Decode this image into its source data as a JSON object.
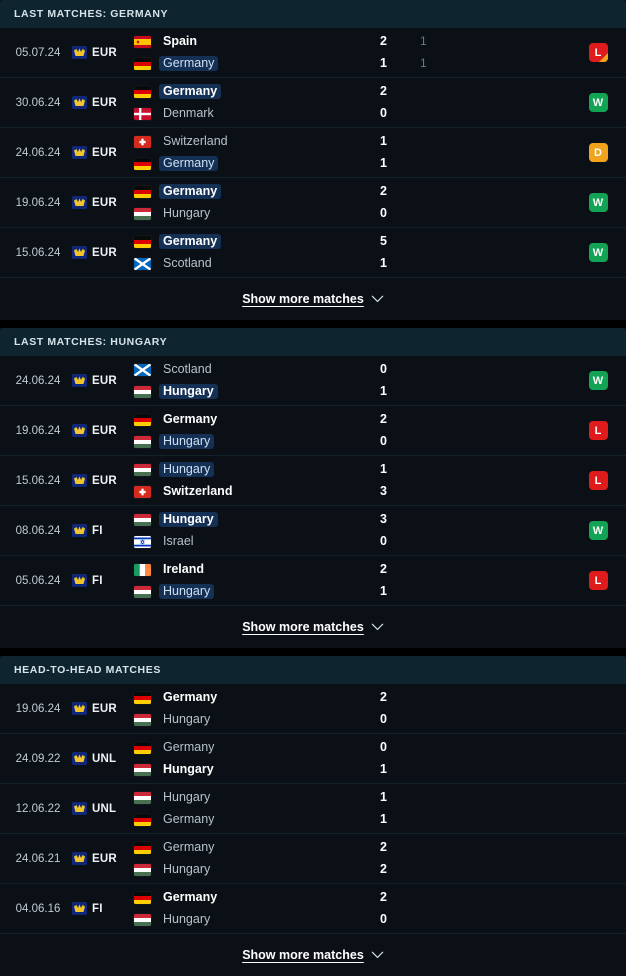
{
  "colors": {
    "background": "#000000",
    "panel": "#0a1016",
    "header_bg": "#0e2530",
    "highlight_pill": "#143055",
    "win": "#13a355",
    "loss": "#e01b1b",
    "draw": "#f0a31b",
    "comp_icon_bg": "#11287a",
    "comp_icon_fg": "#f2c52c"
  },
  "sections": [
    {
      "id": "last-matches-germany",
      "title": "LAST MATCHES: GERMANY",
      "show_more": {
        "label": "Show more matches",
        "icon": "chevron-down-icon"
      },
      "matches": [
        {
          "date": "05.07.24",
          "competition": {
            "code": "EUR",
            "icon": "uefa-euro-icon"
          },
          "home": {
            "name": "Spain",
            "flag": "es",
            "winner": true,
            "highlight": false,
            "score": "2",
            "score2": "1"
          },
          "away": {
            "name": "Germany",
            "flag": "de",
            "winner": false,
            "highlight": true,
            "score": "1",
            "score2": "1"
          },
          "result": {
            "letter": "L",
            "type": "loss",
            "penalty_corner": true
          }
        },
        {
          "date": "30.06.24",
          "competition": {
            "code": "EUR",
            "icon": "uefa-euro-icon"
          },
          "home": {
            "name": "Germany",
            "flag": "de",
            "winner": true,
            "highlight": true,
            "score": "2",
            "score2": ""
          },
          "away": {
            "name": "Denmark",
            "flag": "dk",
            "winner": false,
            "highlight": false,
            "score": "0",
            "score2": ""
          },
          "result": {
            "letter": "W",
            "type": "win",
            "penalty_corner": false
          }
        },
        {
          "date": "24.06.24",
          "competition": {
            "code": "EUR",
            "icon": "uefa-euro-icon"
          },
          "home": {
            "name": "Switzerland",
            "flag": "ch",
            "winner": false,
            "highlight": false,
            "score": "1",
            "score2": ""
          },
          "away": {
            "name": "Germany",
            "flag": "de",
            "winner": false,
            "highlight": true,
            "score": "1",
            "score2": ""
          },
          "result": {
            "letter": "D",
            "type": "draw",
            "penalty_corner": false
          }
        },
        {
          "date": "19.06.24",
          "competition": {
            "code": "EUR",
            "icon": "uefa-euro-icon"
          },
          "home": {
            "name": "Germany",
            "flag": "de",
            "winner": true,
            "highlight": true,
            "score": "2",
            "score2": ""
          },
          "away": {
            "name": "Hungary",
            "flag": "hu",
            "winner": false,
            "highlight": false,
            "score": "0",
            "score2": ""
          },
          "result": {
            "letter": "W",
            "type": "win",
            "penalty_corner": false
          }
        },
        {
          "date": "15.06.24",
          "competition": {
            "code": "EUR",
            "icon": "uefa-euro-icon"
          },
          "home": {
            "name": "Germany",
            "flag": "de",
            "winner": true,
            "highlight": true,
            "score": "5",
            "score2": ""
          },
          "away": {
            "name": "Scotland",
            "flag": "sc",
            "winner": false,
            "highlight": false,
            "score": "1",
            "score2": ""
          },
          "result": {
            "letter": "W",
            "type": "win",
            "penalty_corner": false
          }
        }
      ]
    },
    {
      "id": "last-matches-hungary",
      "title": "LAST MATCHES: HUNGARY",
      "show_more": {
        "label": "Show more matches",
        "icon": "chevron-down-icon"
      },
      "matches": [
        {
          "date": "24.06.24",
          "competition": {
            "code": "EUR",
            "icon": "uefa-euro-icon"
          },
          "home": {
            "name": "Scotland",
            "flag": "sc",
            "winner": false,
            "highlight": false,
            "score": "0",
            "score2": ""
          },
          "away": {
            "name": "Hungary",
            "flag": "hu",
            "winner": true,
            "highlight": true,
            "score": "1",
            "score2": ""
          },
          "result": {
            "letter": "W",
            "type": "win",
            "penalty_corner": false
          }
        },
        {
          "date": "19.06.24",
          "competition": {
            "code": "EUR",
            "icon": "uefa-euro-icon"
          },
          "home": {
            "name": "Germany",
            "flag": "de",
            "winner": true,
            "highlight": false,
            "score": "2",
            "score2": ""
          },
          "away": {
            "name": "Hungary",
            "flag": "hu",
            "winner": false,
            "highlight": true,
            "score": "0",
            "score2": ""
          },
          "result": {
            "letter": "L",
            "type": "loss",
            "penalty_corner": false
          }
        },
        {
          "date": "15.06.24",
          "competition": {
            "code": "EUR",
            "icon": "uefa-euro-icon"
          },
          "home": {
            "name": "Hungary",
            "flag": "hu",
            "winner": false,
            "highlight": true,
            "score": "1",
            "score2": ""
          },
          "away": {
            "name": "Switzerland",
            "flag": "ch",
            "winner": true,
            "highlight": false,
            "score": "3",
            "score2": ""
          },
          "result": {
            "letter": "L",
            "type": "loss",
            "penalty_corner": false
          }
        },
        {
          "date": "08.06.24",
          "competition": {
            "code": "FI",
            "icon": "uefa-euro-icon"
          },
          "home": {
            "name": "Hungary",
            "flag": "hu",
            "winner": true,
            "highlight": true,
            "score": "3",
            "score2": ""
          },
          "away": {
            "name": "Israel",
            "flag": "il",
            "winner": false,
            "highlight": false,
            "score": "0",
            "score2": ""
          },
          "result": {
            "letter": "W",
            "type": "win",
            "penalty_corner": false
          }
        },
        {
          "date": "05.06.24",
          "competition": {
            "code": "FI",
            "icon": "uefa-euro-icon"
          },
          "home": {
            "name": "Ireland",
            "flag": "ie",
            "winner": true,
            "highlight": false,
            "score": "2",
            "score2": ""
          },
          "away": {
            "name": "Hungary",
            "flag": "hu",
            "winner": false,
            "highlight": true,
            "score": "1",
            "score2": ""
          },
          "result": {
            "letter": "L",
            "type": "loss",
            "penalty_corner": false
          }
        }
      ]
    },
    {
      "id": "head-to-head-matches",
      "title": "HEAD-TO-HEAD MATCHES",
      "show_more": {
        "label": "Show more matches",
        "icon": "chevron-down-icon"
      },
      "matches": [
        {
          "date": "19.06.24",
          "competition": {
            "code": "EUR",
            "icon": "uefa-euro-icon"
          },
          "home": {
            "name": "Germany",
            "flag": "de",
            "winner": true,
            "highlight": false,
            "score": "2",
            "score2": ""
          },
          "away": {
            "name": "Hungary",
            "flag": "hu",
            "winner": false,
            "highlight": false,
            "score": "0",
            "score2": ""
          },
          "result": null
        },
        {
          "date": "24.09.22",
          "competition": {
            "code": "UNL",
            "icon": "uefa-euro-icon"
          },
          "home": {
            "name": "Germany",
            "flag": "de",
            "winner": false,
            "highlight": false,
            "score": "0",
            "score2": ""
          },
          "away": {
            "name": "Hungary",
            "flag": "hu",
            "winner": true,
            "highlight": false,
            "score": "1",
            "score2": ""
          },
          "result": null
        },
        {
          "date": "12.06.22",
          "competition": {
            "code": "UNL",
            "icon": "uefa-euro-icon"
          },
          "home": {
            "name": "Hungary",
            "flag": "hu",
            "winner": false,
            "highlight": false,
            "score": "1",
            "score2": ""
          },
          "away": {
            "name": "Germany",
            "flag": "de",
            "winner": false,
            "highlight": false,
            "score": "1",
            "score2": ""
          },
          "result": null
        },
        {
          "date": "24.06.21",
          "competition": {
            "code": "EUR",
            "icon": "uefa-euro-icon"
          },
          "home": {
            "name": "Germany",
            "flag": "de",
            "winner": false,
            "highlight": false,
            "score": "2",
            "score2": ""
          },
          "away": {
            "name": "Hungary",
            "flag": "hu",
            "winner": false,
            "highlight": false,
            "score": "2",
            "score2": ""
          },
          "result": null
        },
        {
          "date": "04.06.16",
          "competition": {
            "code": "FI",
            "icon": "uefa-euro-icon"
          },
          "home": {
            "name": "Germany",
            "flag": "de",
            "winner": true,
            "highlight": false,
            "score": "2",
            "score2": ""
          },
          "away": {
            "name": "Hungary",
            "flag": "hu",
            "winner": false,
            "highlight": false,
            "score": "0",
            "score2": ""
          },
          "result": null
        }
      ]
    }
  ]
}
